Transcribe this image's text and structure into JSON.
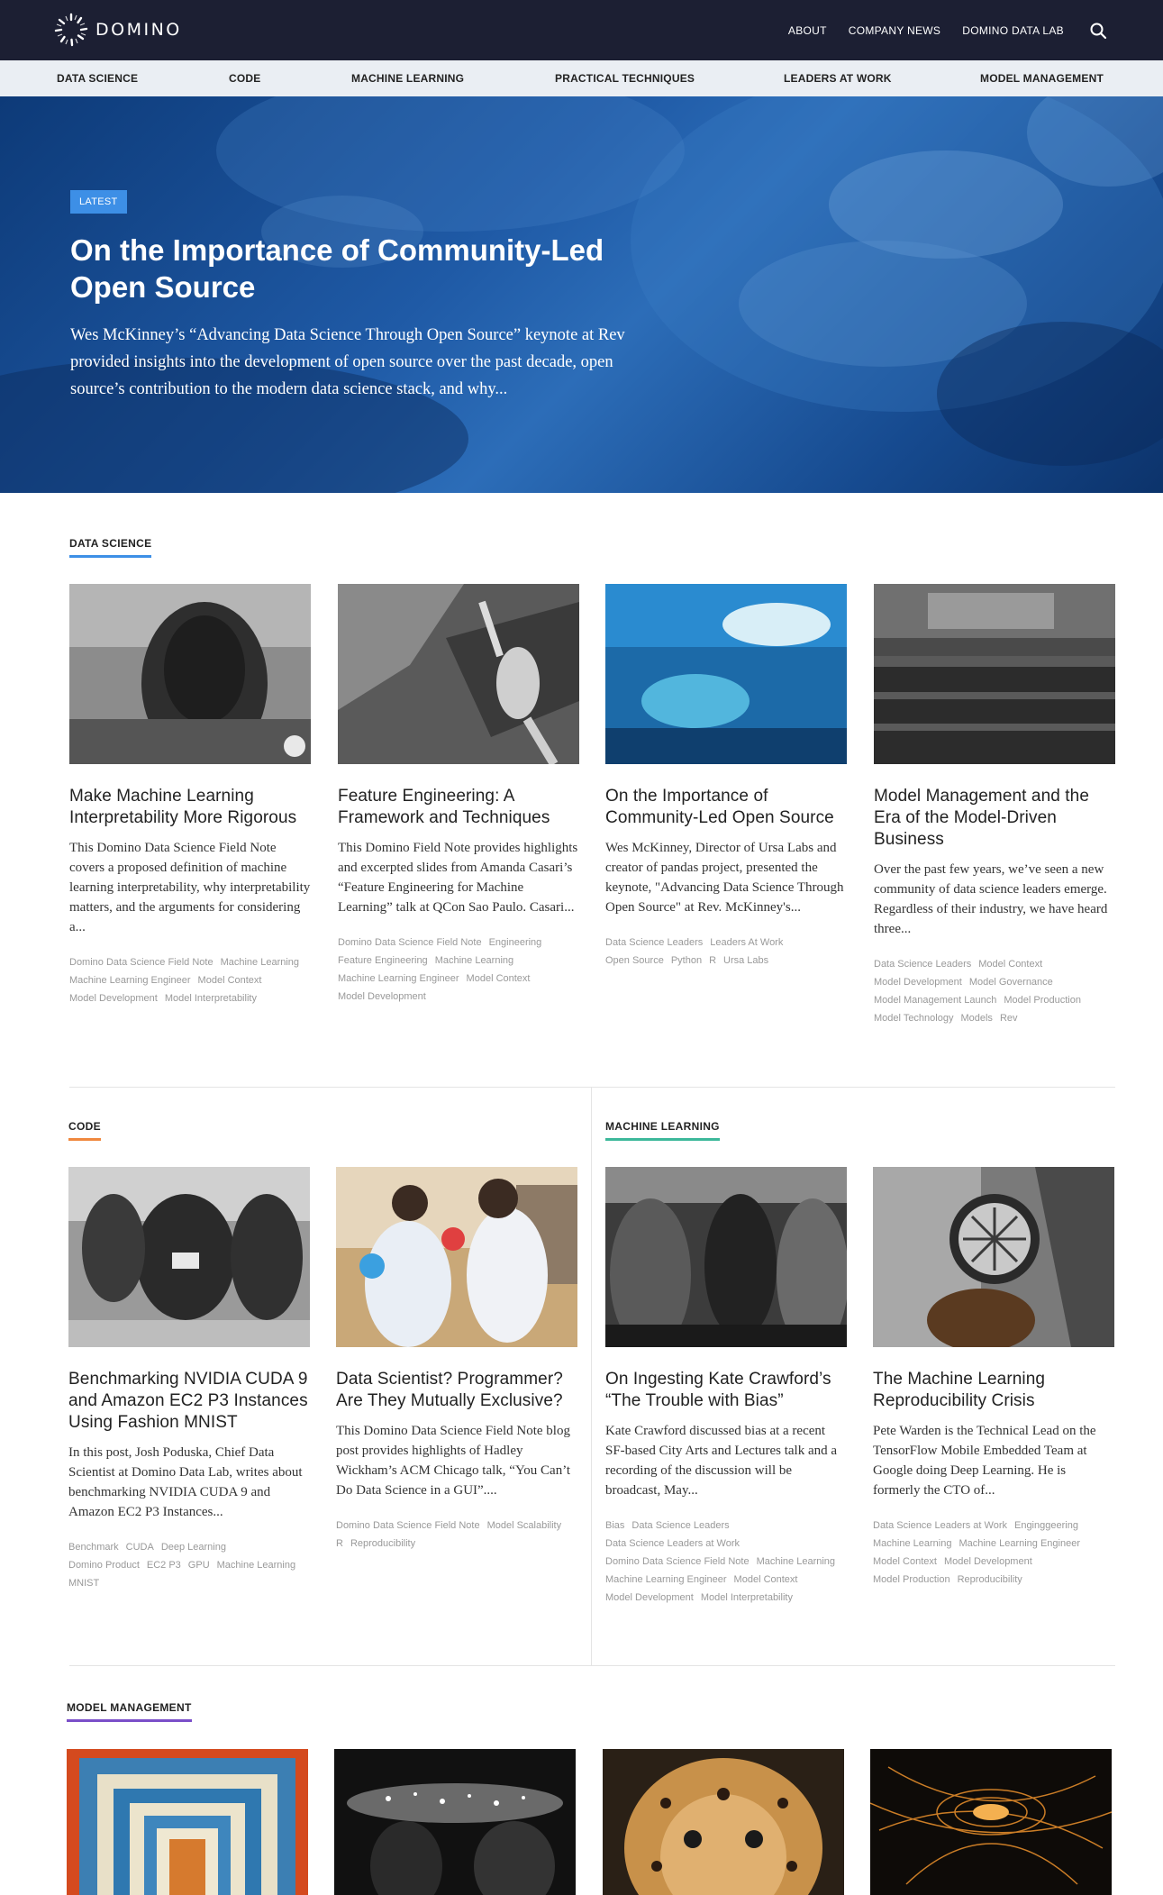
{
  "header": {
    "logo_text": "DOMINO",
    "nav": [
      "ABOUT",
      "COMPANY NEWS",
      "DOMINO DATA LAB"
    ]
  },
  "categories": [
    "DATA SCIENCE",
    "CODE",
    "MACHINE LEARNING",
    "PRACTICAL TECHNIQUES",
    "LEADERS AT WORK",
    "MODEL MANAGEMENT"
  ],
  "hero": {
    "badge": "LATEST",
    "title": "On the Importance of Community-Led Open Source",
    "excerpt": "Wes McKinney’s “Advancing Data Science Through Open Source” keynote at Rev provided insights into the development of open source over the past decade, open source’s contribution to the modern data science stack, and why..."
  },
  "sections": {
    "data_science": {
      "label": "DATA SCIENCE",
      "accent": "#3d8fe6",
      "cards": [
        {
          "title": "Make Machine Learning Interpretability More Rigorous",
          "excerpt": "This Domino Data Science Field Note covers a proposed definition of machine learning interpretability, why interpretability matters, and the arguments for considering a...",
          "tags": [
            "Domino Data Science Field Note",
            "Machine Learning",
            "Machine Learning Engineer",
            "Model Context",
            "Model Development",
            "Model Interpretability"
          ]
        },
        {
          "title": "Feature Engineering: A Framework and Techniques",
          "excerpt": "This Domino Field Note provides highlights and excerpted slides from Amanda Casari’s “Feature Engineering for Machine Learning” talk at QCon Sao Paulo. Casari...",
          "tags": [
            "Domino Data Science Field Note",
            "Engineering",
            "Feature Engineering",
            "Machine Learning",
            "Machine Learning Engineer",
            "Model Context",
            "Model Development"
          ]
        },
        {
          "title": "On the Importance of Community-Led Open Source",
          "excerpt": "Wes McKinney, Director of Ursa Labs and creator of pandas project, presented the keynote, \"Advancing Data Science Through Open Source\" at Rev. McKinney's...",
          "tags": [
            "Data Science Leaders",
            "Leaders At Work",
            "Open Source",
            "Python",
            "R",
            "Ursa Labs"
          ]
        },
        {
          "title": "Model Management and the Era of the Model-Driven Business",
          "excerpt": "Over the past few years, we’ve seen a new community of data science leaders emerge. Regardless of their industry, we have heard three...",
          "tags": [
            "Data Science Leaders",
            "Model Context",
            "Model Development",
            "Model Governance",
            "Model Management Launch",
            "Model Production",
            "Model Technology",
            "Models",
            "Rev"
          ]
        }
      ]
    },
    "code": {
      "label": "CODE",
      "accent": "#f0883e",
      "cards": [
        {
          "title": "Benchmarking NVIDIA CUDA 9 and Amazon EC2 P3 Instances Using Fashion MNIST",
          "excerpt": "In this post, Josh Poduska, Chief Data Scientist at Domino Data Lab, writes about benchmarking NVIDIA CUDA 9 and Amazon EC2 P3 Instances...",
          "tags": [
            "Benchmark",
            "CUDA",
            "Deep Learning",
            "Domino Product",
            "EC2 P3",
            "GPU",
            "Machine Learning",
            "MNIST"
          ]
        },
        {
          "title": "Data Scientist? Programmer? Are They Mutually Exclusive?",
          "excerpt": "This Domino Data Science Field Note blog post provides highlights of Hadley Wickham’s ACM Chicago talk, “You Can’t Do Data Science in a GUI”....",
          "tags": [
            "Domino Data Science Field Note",
            "Model Scalability",
            "R",
            "Reproducibility"
          ]
        }
      ]
    },
    "machine_learning": {
      "label": "MACHINE LEARNING",
      "accent": "#3cb89a",
      "cards": [
        {
          "title": "On Ingesting Kate Crawford’s “The Trouble with Bias”",
          "excerpt": "Kate Crawford discussed bias at a recent SF-based City Arts and Lectures talk and a recording of the discussion will be broadcast, May...",
          "tags": [
            "Bias",
            "Data Science Leaders",
            "Data Science Leaders at Work",
            "Domino Data Science Field Note",
            "Machine Learning",
            "Machine Learning Engineer",
            "Model Context",
            "Model Development",
            "Model Interpretability"
          ]
        },
        {
          "title": "The Machine Learning Reproducibility Crisis",
          "excerpt": "Pete Warden is the Technical Lead on the TensorFlow Mobile Embedded Team at Google doing Deep Learning. He is formerly the CTO of...",
          "tags": [
            "Data Science Leaders at Work",
            "Enginggeering",
            "Machine Learning",
            "Machine Learning Engineer",
            "Model Context",
            "Model Development",
            "Model Production",
            "Reproducibility"
          ]
        }
      ]
    },
    "model_management": {
      "label": "MODEL MANAGEMENT",
      "accent": "#7a4fc9"
    }
  }
}
